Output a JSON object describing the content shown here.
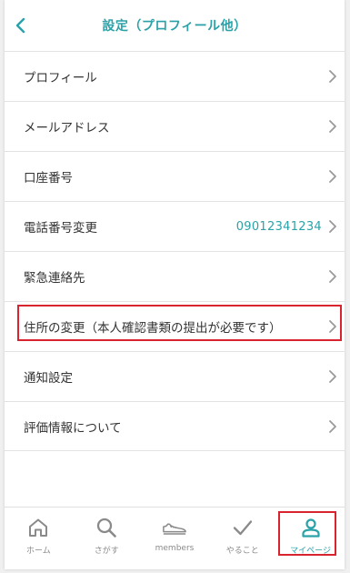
{
  "header": {
    "title": "設定（プロフィール他）",
    "back_icon": "chevron-left-icon"
  },
  "colors": {
    "accent": "#2aa2a8",
    "highlight": "#d9232e",
    "text": "#333333",
    "muted": "#8a8a8a"
  },
  "settings": {
    "items": [
      {
        "label": "プロフィール",
        "value": ""
      },
      {
        "label": "メールアドレス",
        "value": ""
      },
      {
        "label": "口座番号",
        "value": ""
      },
      {
        "label": "電話番号変更",
        "value": "09012341234"
      },
      {
        "label": "緊急連絡先",
        "value": ""
      },
      {
        "label": "住所の変更（本人確認書類の提出が必要です）",
        "value": ""
      },
      {
        "label": "通知設定",
        "value": ""
      },
      {
        "label": "評価情報について",
        "value": ""
      }
    ]
  },
  "tabbar": {
    "tabs": [
      {
        "label": "ホーム",
        "icon": "home-icon"
      },
      {
        "label": "さがす",
        "icon": "search-icon"
      },
      {
        "label": "members",
        "icon": "shoe-icon"
      },
      {
        "label": "やること",
        "icon": "checkmark-icon"
      },
      {
        "label": "マイページ",
        "icon": "user-icon",
        "active": true
      }
    ]
  }
}
